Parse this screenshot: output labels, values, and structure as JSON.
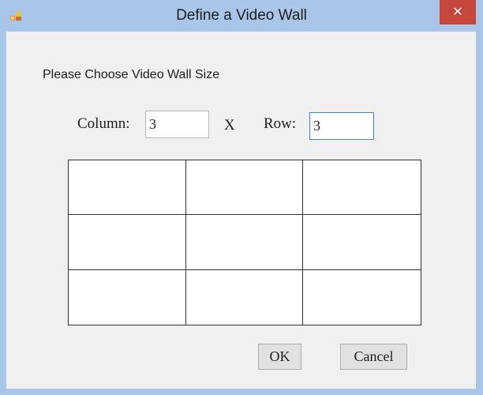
{
  "window": {
    "title": "Define a Video Wall",
    "close_glyph": "✕",
    "icon": "app-window-icon"
  },
  "dialog": {
    "prompt": "Please Choose Video Wall Size",
    "column_label": "Column:",
    "column_value": "3",
    "separator": "X",
    "row_label": "Row:",
    "row_value": "3",
    "grid": {
      "columns": 3,
      "rows": 3
    },
    "ok_label": "OK",
    "cancel_label": "Cancel"
  },
  "colors": {
    "titlebar": "#a9c6ea",
    "close_button": "#c7473d",
    "client_background": "#f0f0f0",
    "focused_input_border": "#3c87d6"
  }
}
